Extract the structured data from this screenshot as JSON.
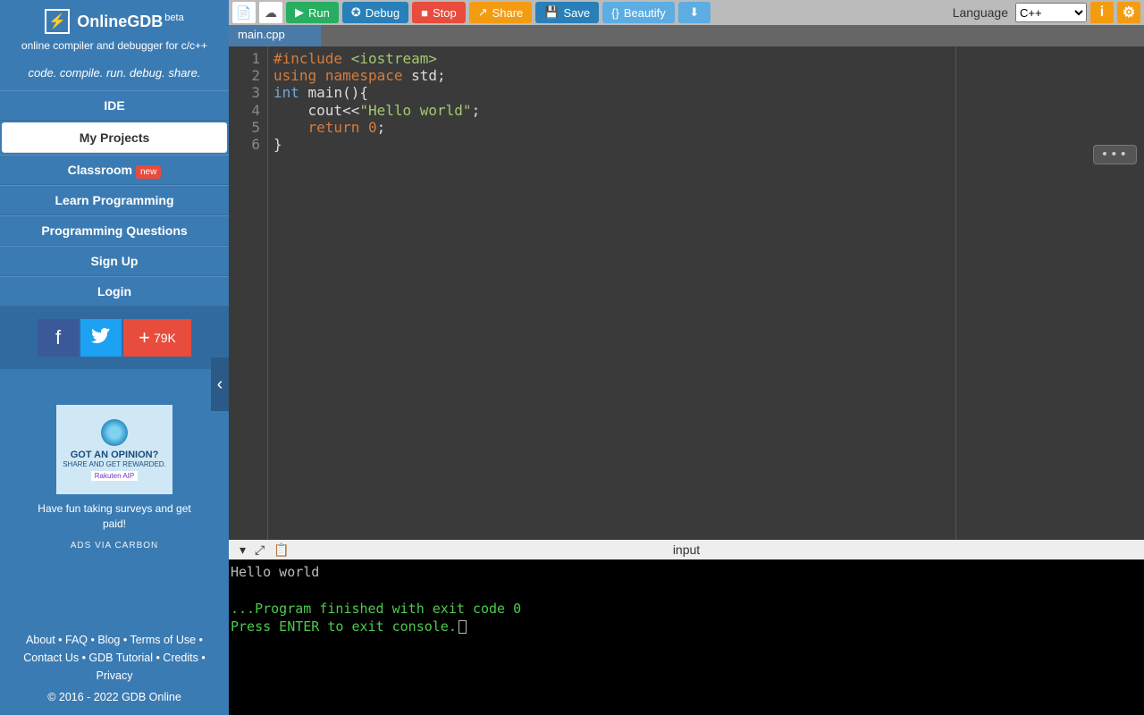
{
  "sidebar": {
    "title": "OnlineGDB",
    "beta": "beta",
    "subtitle": "online compiler and debugger for c/c++",
    "tagline": "code. compile. run. debug. share.",
    "nav": [
      {
        "label": "IDE"
      },
      {
        "label": "My Projects"
      },
      {
        "label": "Classroom",
        "badge": "new"
      },
      {
        "label": "Learn Programming"
      },
      {
        "label": "Programming Questions"
      },
      {
        "label": "Sign Up"
      },
      {
        "label": "Login"
      }
    ],
    "share_count": "79K",
    "ad": {
      "headline": "GOT AN OPINION?",
      "sub": "SHARE AND GET REWARDED.",
      "brand": "Rakuten AIP",
      "text": "Have fun taking surveys and get paid!",
      "via": "ADS VIA CARBON"
    },
    "footer": {
      "links": "About • FAQ • Blog • Terms of Use • Contact Us • GDB Tutorial • Credits • Privacy",
      "copyright": "© 2016 - 2022 GDB Online"
    }
  },
  "toolbar": {
    "run": "Run",
    "debug": "Debug",
    "stop": "Stop",
    "share": "Share",
    "save": "Save",
    "beautify": "Beautify",
    "language_label": "Language",
    "language_value": "C++"
  },
  "tabs": [
    {
      "label": "main.cpp"
    }
  ],
  "code": {
    "lines": [
      "1",
      "2",
      "3",
      "4",
      "5",
      "6"
    ],
    "source": "#include <iostream>\nusing namespace std;\nint main(){\n    cout<<\"Hello world\";\n    return 0;\n}"
  },
  "console": {
    "title": "input",
    "line1": "Hello world",
    "line2": "...Program finished with exit code 0",
    "line3": "Press ENTER to exit console."
  }
}
